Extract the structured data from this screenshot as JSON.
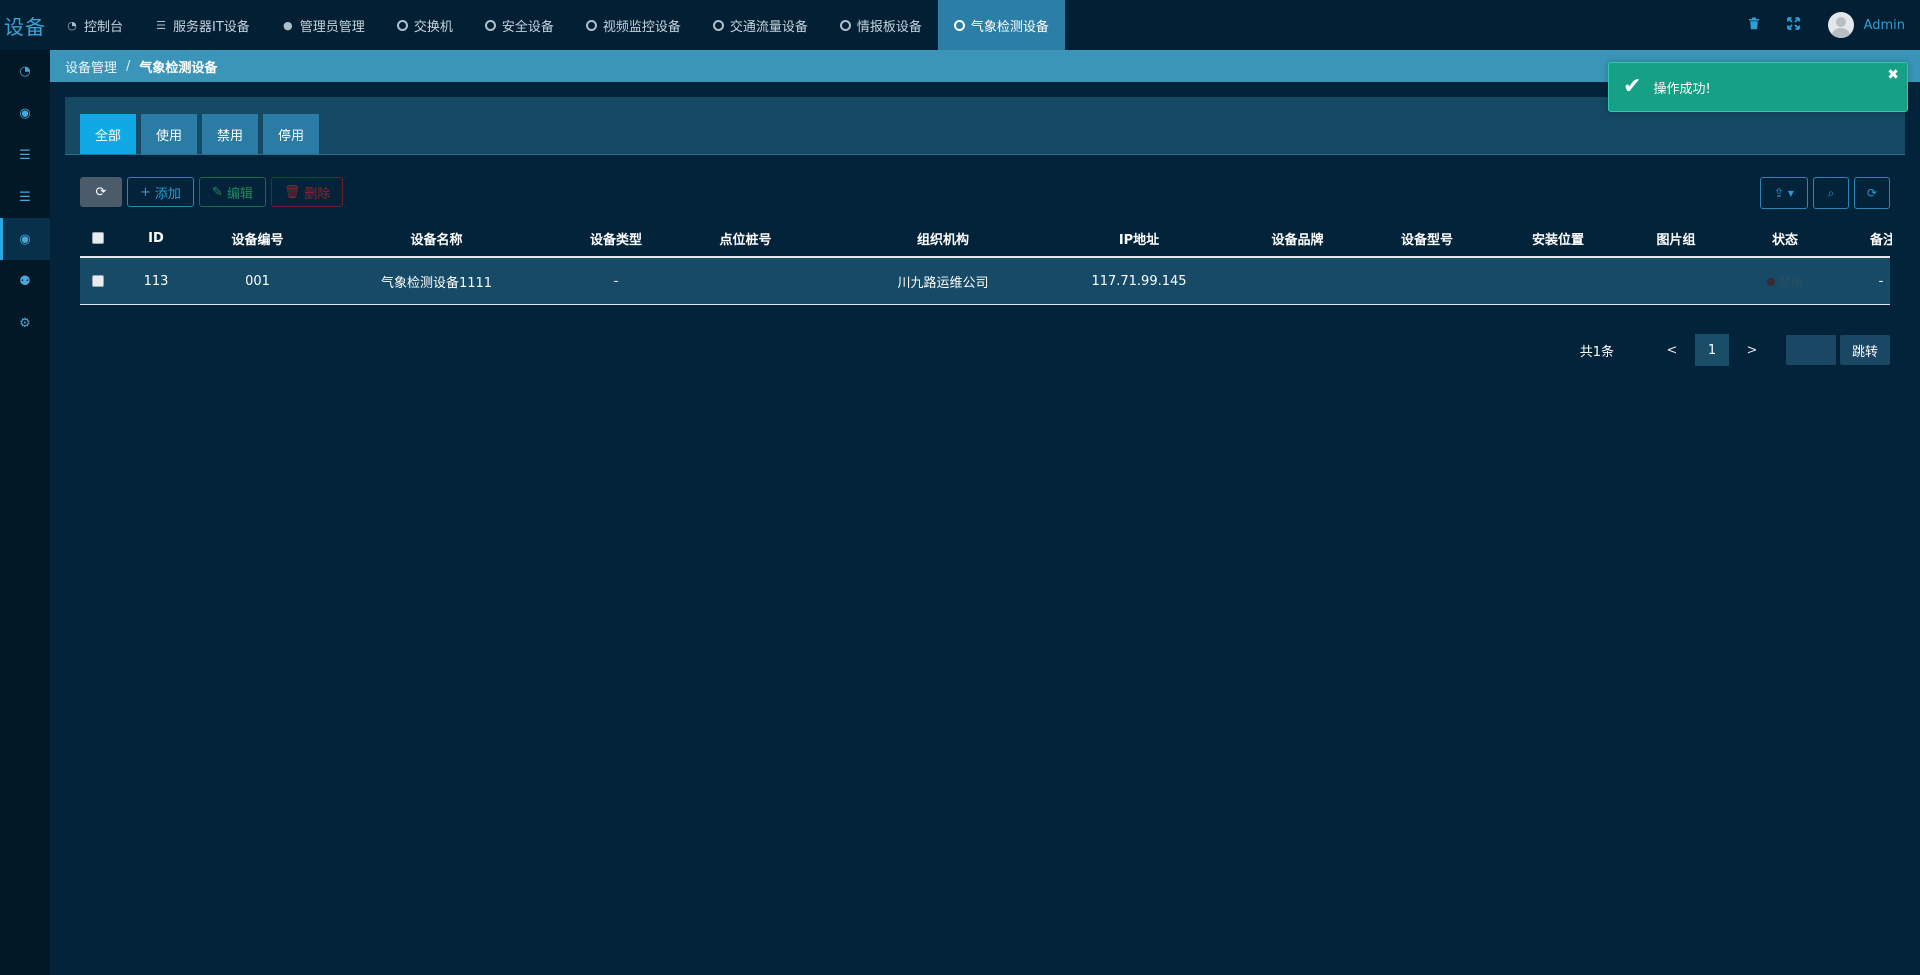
{
  "brand": "设备",
  "nav": {
    "tabs": [
      {
        "label": "控制台",
        "icon": "dashboard-icon"
      },
      {
        "label": "服务器IT设备",
        "icon": "server-icon"
      },
      {
        "label": "管理员管理",
        "icon": "user-icon"
      },
      {
        "label": "交换机",
        "icon": "circle-icon"
      },
      {
        "label": "安全设备",
        "icon": "circle-icon"
      },
      {
        "label": "视频监控设备",
        "icon": "circle-icon"
      },
      {
        "label": "交通流量设备",
        "icon": "circle-icon"
      },
      {
        "label": "情报板设备",
        "icon": "circle-icon"
      },
      {
        "label": "气象检测设备",
        "icon": "circle-icon",
        "active": true
      }
    ],
    "user": "Admin"
  },
  "breadcrumb": {
    "parent": "设备管理",
    "separator": "/",
    "current": "气象检测设备"
  },
  "filter_tabs": [
    "全部",
    "使用",
    "禁用",
    "停用"
  ],
  "toolbar": {
    "add": "添加",
    "edit": "编辑",
    "delete": "删除"
  },
  "table": {
    "headers": [
      "ID",
      "设备编号",
      "设备名称",
      "设备类型",
      "点位桩号",
      "组织机构",
      "IP地址",
      "设备品牌",
      "设备型号",
      "安装位置",
      "图片组",
      "状态",
      "备注"
    ],
    "rows": [
      {
        "id": "113",
        "no": "001",
        "name": "气象检测设备1111",
        "type": "-",
        "point": "",
        "org": "川九路运维公司",
        "ip": "117.71.99.145",
        "brand": "",
        "model": "",
        "location": "",
        "images": "",
        "status": "禁用",
        "note": "-"
      }
    ]
  },
  "pager": {
    "total": "共1条",
    "prev": "<",
    "current": "1",
    "next": ">",
    "jump": "跳转"
  },
  "toast": {
    "message": "操作成功!"
  },
  "colors": {
    "accent": "#10a9e6",
    "success": "#16a085",
    "topbar": "#021f33",
    "crumb": "#3a95b8"
  }
}
